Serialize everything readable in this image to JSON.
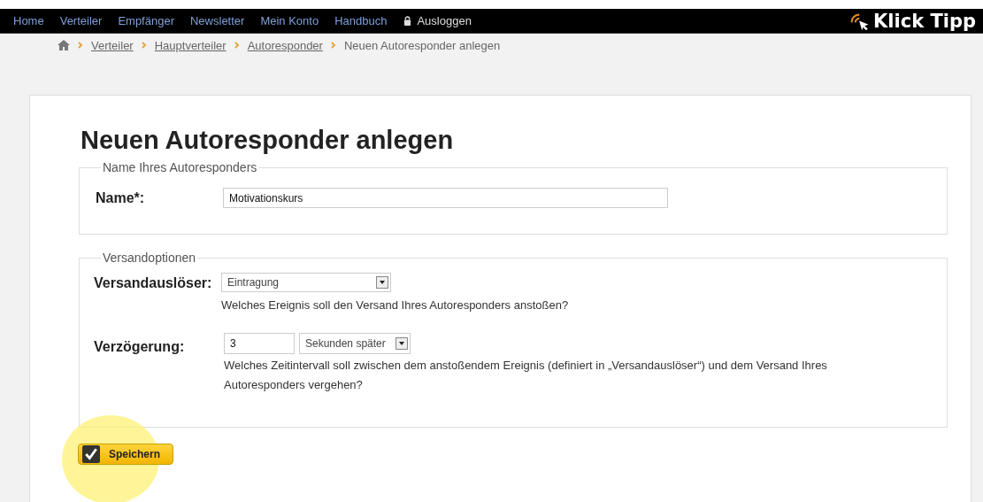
{
  "nav": {
    "items": [
      {
        "label": "Home",
        "icon": false
      },
      {
        "label": "Verteiler",
        "icon": false
      },
      {
        "label": "Empfänger",
        "icon": false
      },
      {
        "label": "Newsletter",
        "icon": false
      },
      {
        "label": "Mein Konto",
        "icon": false
      },
      {
        "label": "Handbuch",
        "icon": false
      },
      {
        "label": "Ausloggen",
        "icon": true
      }
    ],
    "logo": "Klick Tipp"
  },
  "breadcrumb": [
    {
      "label": "Verteiler",
      "link": true
    },
    {
      "label": "Hauptverteiler",
      "link": true
    },
    {
      "label": "Autoresponder",
      "link": true
    },
    {
      "label": "Neuen Autoresponder anlegen",
      "link": false
    }
  ],
  "title": "Neuen Autoresponder anlegen",
  "name_section": {
    "legend": "Name Ihres Autoresponders",
    "label": "Name*:",
    "value": "Motivationskurs"
  },
  "options_section": {
    "legend": "Versandoptionen",
    "trigger": {
      "label": "Versandauslöser:",
      "value": "Eintragung",
      "help": "Welches Ereignis soll den Versand Ihres Autoresponders anstoßen?"
    },
    "delay": {
      "label": "Verzögerung:",
      "value": "3",
      "unit": "Sekunden später",
      "help": "Welches Zeitintervall soll zwischen dem anstoßendem Ereignis (definiert in „Versandauslöser“) und dem Versand Ihres Autoresponders vergehen?"
    }
  },
  "save_button": "Speichern"
}
